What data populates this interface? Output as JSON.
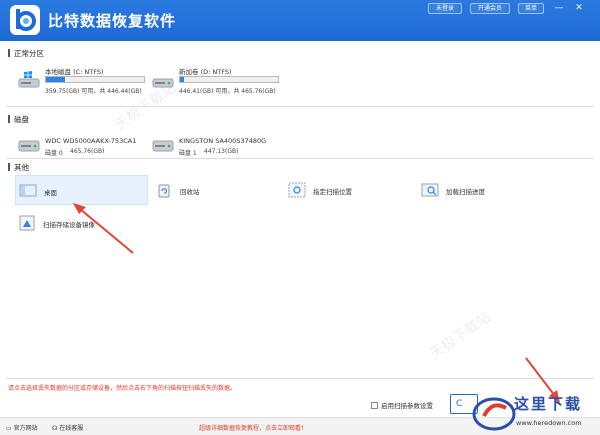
{
  "window": {
    "title": "比特数据恢复软件",
    "buttons": {
      "login": "未登录",
      "vip": "开通会员",
      "menu": "菜单"
    },
    "controls": {
      "minimize": "—",
      "close": "✕"
    }
  },
  "sections": {
    "partitions": "正常分区",
    "disks": "磁盘",
    "others": "其他"
  },
  "partitions": [
    {
      "name": "本地磁盘 (C: NTFS)",
      "usage": "359.75(GB) 可用，共 446.44(GB)",
      "used_percent": 19
    },
    {
      "name": "新加卷 (D: NTFS)",
      "usage": "446.41(GB) 可用，共 465.76(GB)",
      "used_percent": 4
    }
  ],
  "disks": [
    {
      "name": "WDC WD5000AAKX-753CA1",
      "index": "磁盘 0",
      "size": "465.76(GB)"
    },
    {
      "name": "KINGSTON SA400S37480G",
      "index": "磁盘 1",
      "size": "447.13(GB)"
    }
  ],
  "others": {
    "desktop": "桌面",
    "recycle": "回收站",
    "location": "指定扫描位置",
    "load": "加载扫描进度",
    "storage": "扫描存储设备镜像"
  },
  "bottom": {
    "hint": "请点击选择丢失数据的分区或存储设备，然后点击右下角的扫描按钮扫描丢失的数据。",
    "checkbox": "启用扫描参数设置",
    "next": "C"
  },
  "footer": {
    "website": "官方网站",
    "support": "在线客服",
    "center": "超级详细数据恢复教程，点击立即观看！"
  },
  "watermarks": {
    "a": "天极下载站",
    "b": "天极下载站"
  },
  "brand": {
    "name": "这里下载",
    "url": "www.heredown.com"
  },
  "colors": {
    "titlebar": "#1f6ad6",
    "accent": "#2a85e6",
    "hint": "#e23c2c",
    "arrow": "#e0463a"
  }
}
